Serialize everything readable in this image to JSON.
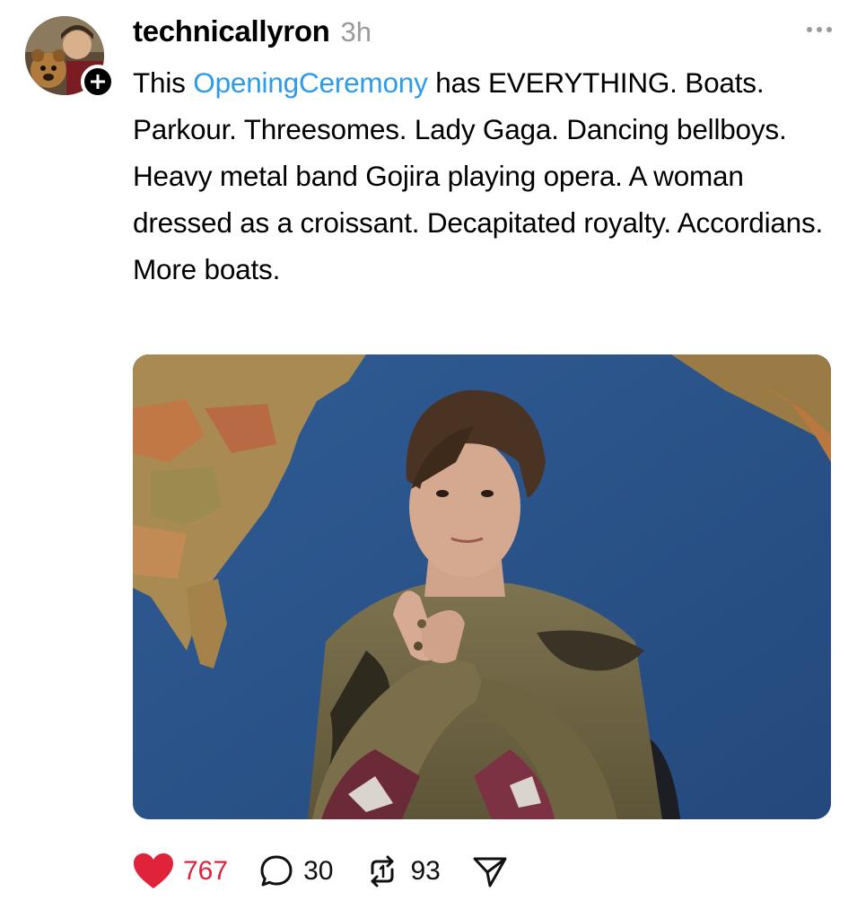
{
  "post": {
    "author": {
      "username": "technicallyron",
      "time": "3h"
    },
    "text": {
      "before_tag": "This ",
      "tag": "OpeningCeremony",
      "after_tag": " has EVERYTHING. Boats. Parkour. Threesomes. Lady Gaga. Dancing bellboys. Heavy metal band Gojira playing opera. A woman dressed as a croissant. Decapitated royalty. Accordians. More boats."
    },
    "media": {
      "type": "image",
      "subject": "man with swoop bangs in front of map backdrop, arms crossed"
    },
    "actions": {
      "likes": "767",
      "replies": "30",
      "reposts": "93",
      "like_icon": "heart-filled-icon",
      "reply_icon": "speech-bubble-icon",
      "repost_icon": "repost-icon",
      "share_icon": "send-icon"
    },
    "colors": {
      "like": "#e0223b",
      "hashtag": "#2e9bea",
      "meta": "#9a9a9a"
    }
  }
}
